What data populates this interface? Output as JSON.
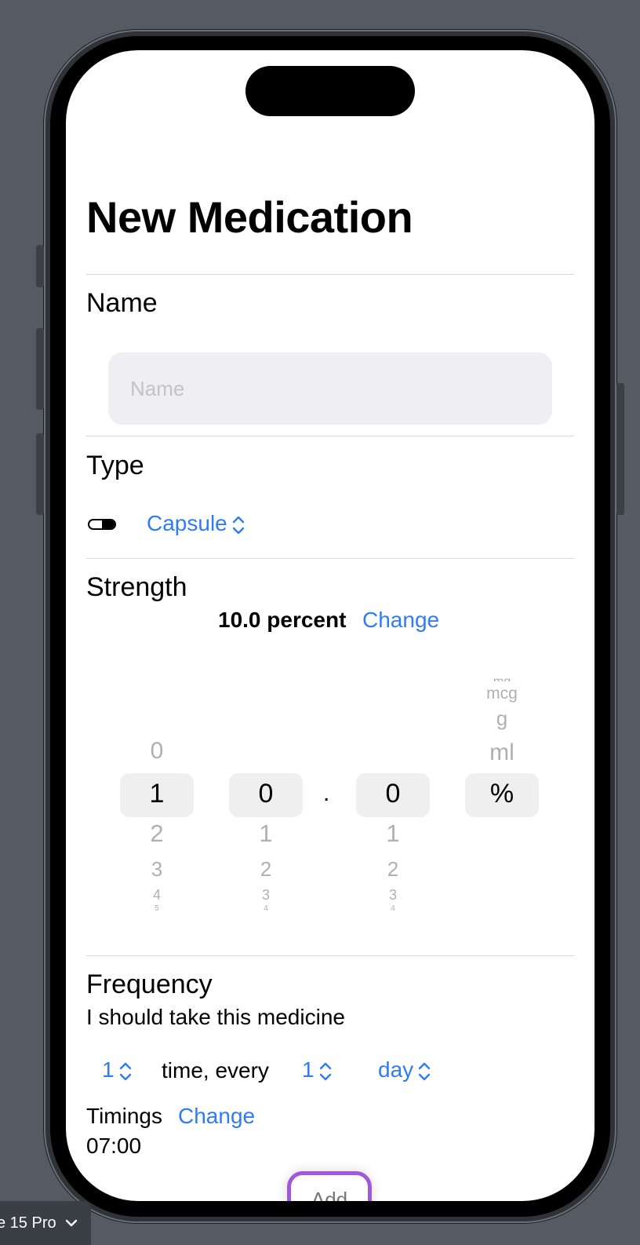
{
  "device_selector": {
    "label": "e 15 Pro"
  },
  "page": {
    "title": "New Medication"
  },
  "name_section": {
    "label": "Name",
    "placeholder": "Name",
    "value": ""
  },
  "type_section": {
    "label": "Type",
    "selected": "Capsule",
    "icon": "capsule-icon"
  },
  "strength_section": {
    "label": "Strength",
    "value_text": "10.0 percent",
    "change_label": "Change",
    "wheels": {
      "tens": {
        "above": [
          "0"
        ],
        "selected": "1",
        "below": [
          "2",
          "3",
          "4",
          "5"
        ]
      },
      "ones": {
        "above": [],
        "selected": "0",
        "below": [
          "1",
          "2",
          "3",
          "4"
        ]
      },
      "decimal_point": ".",
      "tenths": {
        "above": [],
        "selected": "0",
        "below": [
          "1",
          "2",
          "3",
          "4"
        ]
      },
      "unit": {
        "above": [
          "mg",
          "mcg",
          "g",
          "ml"
        ],
        "selected": "%",
        "below": []
      }
    }
  },
  "frequency_section": {
    "label": "Frequency",
    "subtitle": "I should take this medicine",
    "times_value": "1",
    "times_text": "time, every",
    "interval_value": "1",
    "unit_value": "day"
  },
  "timings": {
    "label": "Timings",
    "change_label": "Change",
    "time": "07:00"
  },
  "add_button": {
    "label": "Add"
  },
  "colors": {
    "accent": "#2f7cf6",
    "focus_ring": "#a259d9",
    "field_bg": "#eeeef3"
  }
}
